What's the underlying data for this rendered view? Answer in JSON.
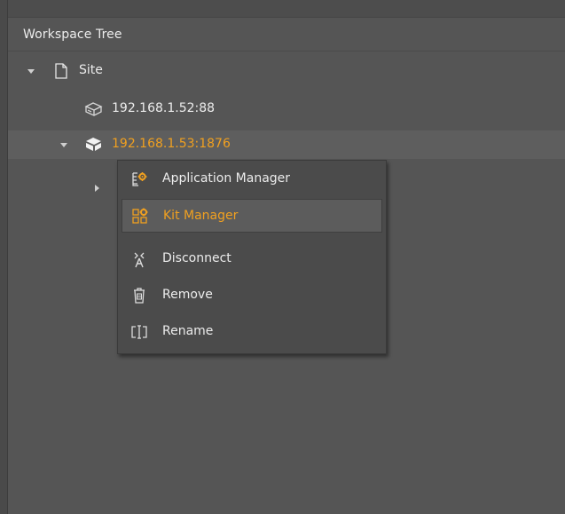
{
  "panel": {
    "title": "Workspace Tree"
  },
  "tree": {
    "site": {
      "label": "Site",
      "icon": "file-icon"
    },
    "host_disconnected": {
      "label": "192.168.1.52:88",
      "icon": "server-outline-icon"
    },
    "host_connected": {
      "label": "192.168.1.53:1876",
      "icon": "server-filled-icon"
    }
  },
  "context_menu": {
    "items": [
      {
        "label": "Application Manager",
        "icon": "application-manager-icon"
      },
      {
        "label": "Kit Manager",
        "icon": "kit-manager-icon"
      },
      {
        "label": "Disconnect",
        "icon": "disconnect-antenna-icon"
      },
      {
        "label": "Remove",
        "icon": "trash-icon"
      },
      {
        "label": "Rename",
        "icon": "rename-icon"
      }
    ]
  },
  "colors": {
    "accent": "#f0a020",
    "panel_bg": "#555555",
    "menu_bg": "#4b4b4b",
    "text": "#ececec"
  }
}
